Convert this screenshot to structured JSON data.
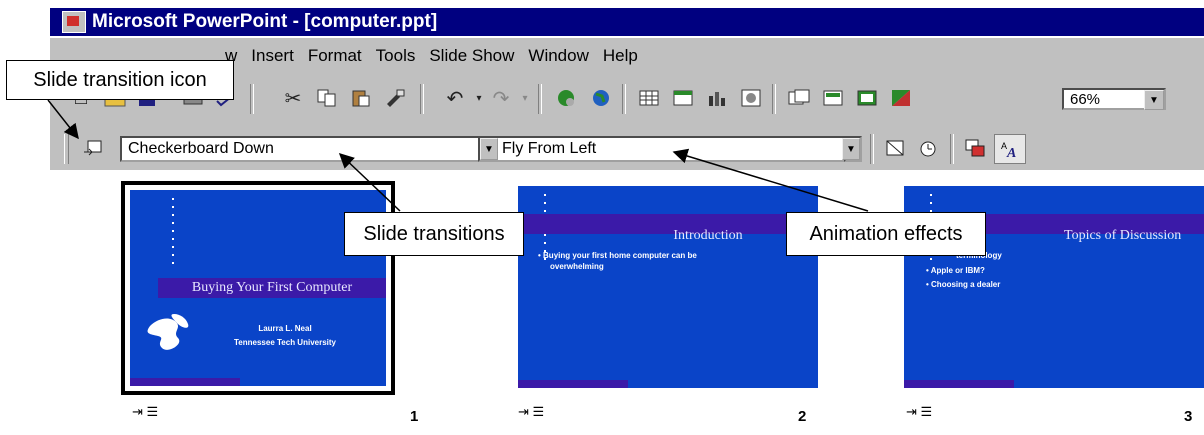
{
  "window": {
    "title": "Microsoft PowerPoint - [computer.ppt]"
  },
  "menu": {
    "items": [
      "w",
      "Insert",
      "Format",
      "Tools",
      "Slide Show",
      "Window",
      "Help"
    ]
  },
  "toolbar": {
    "zoom_value": "66%"
  },
  "animation_toolbar": {
    "transition_value": "Checkerboard Down",
    "animation_value": "Fly From Left"
  },
  "slides": [
    {
      "number": "1",
      "title": "Buying Your First Computer",
      "subtitle_line1": "Laurra L. Neal",
      "subtitle_line2": "Tennessee Tech University"
    },
    {
      "number": "2",
      "title": "Introduction",
      "bullet1": "• Buying your first home computer can be",
      "bullet1b": "overwhelming"
    },
    {
      "number": "3",
      "title": "Topics of Discussion",
      "bullet1": "terminology",
      "bullet2": "• Apple or IBM?",
      "bullet3": "• Choosing a dealer"
    }
  ],
  "callouts": {
    "transition_icon": "Slide transition icon",
    "slide_transitions": "Slide transitions",
    "animation_effects": "Animation effects"
  },
  "colors": {
    "title_bar": "#000080",
    "toolbar": "#c0c0c0",
    "slide_bg": "#0a44c8",
    "slide_band": "#3b1aa8"
  }
}
